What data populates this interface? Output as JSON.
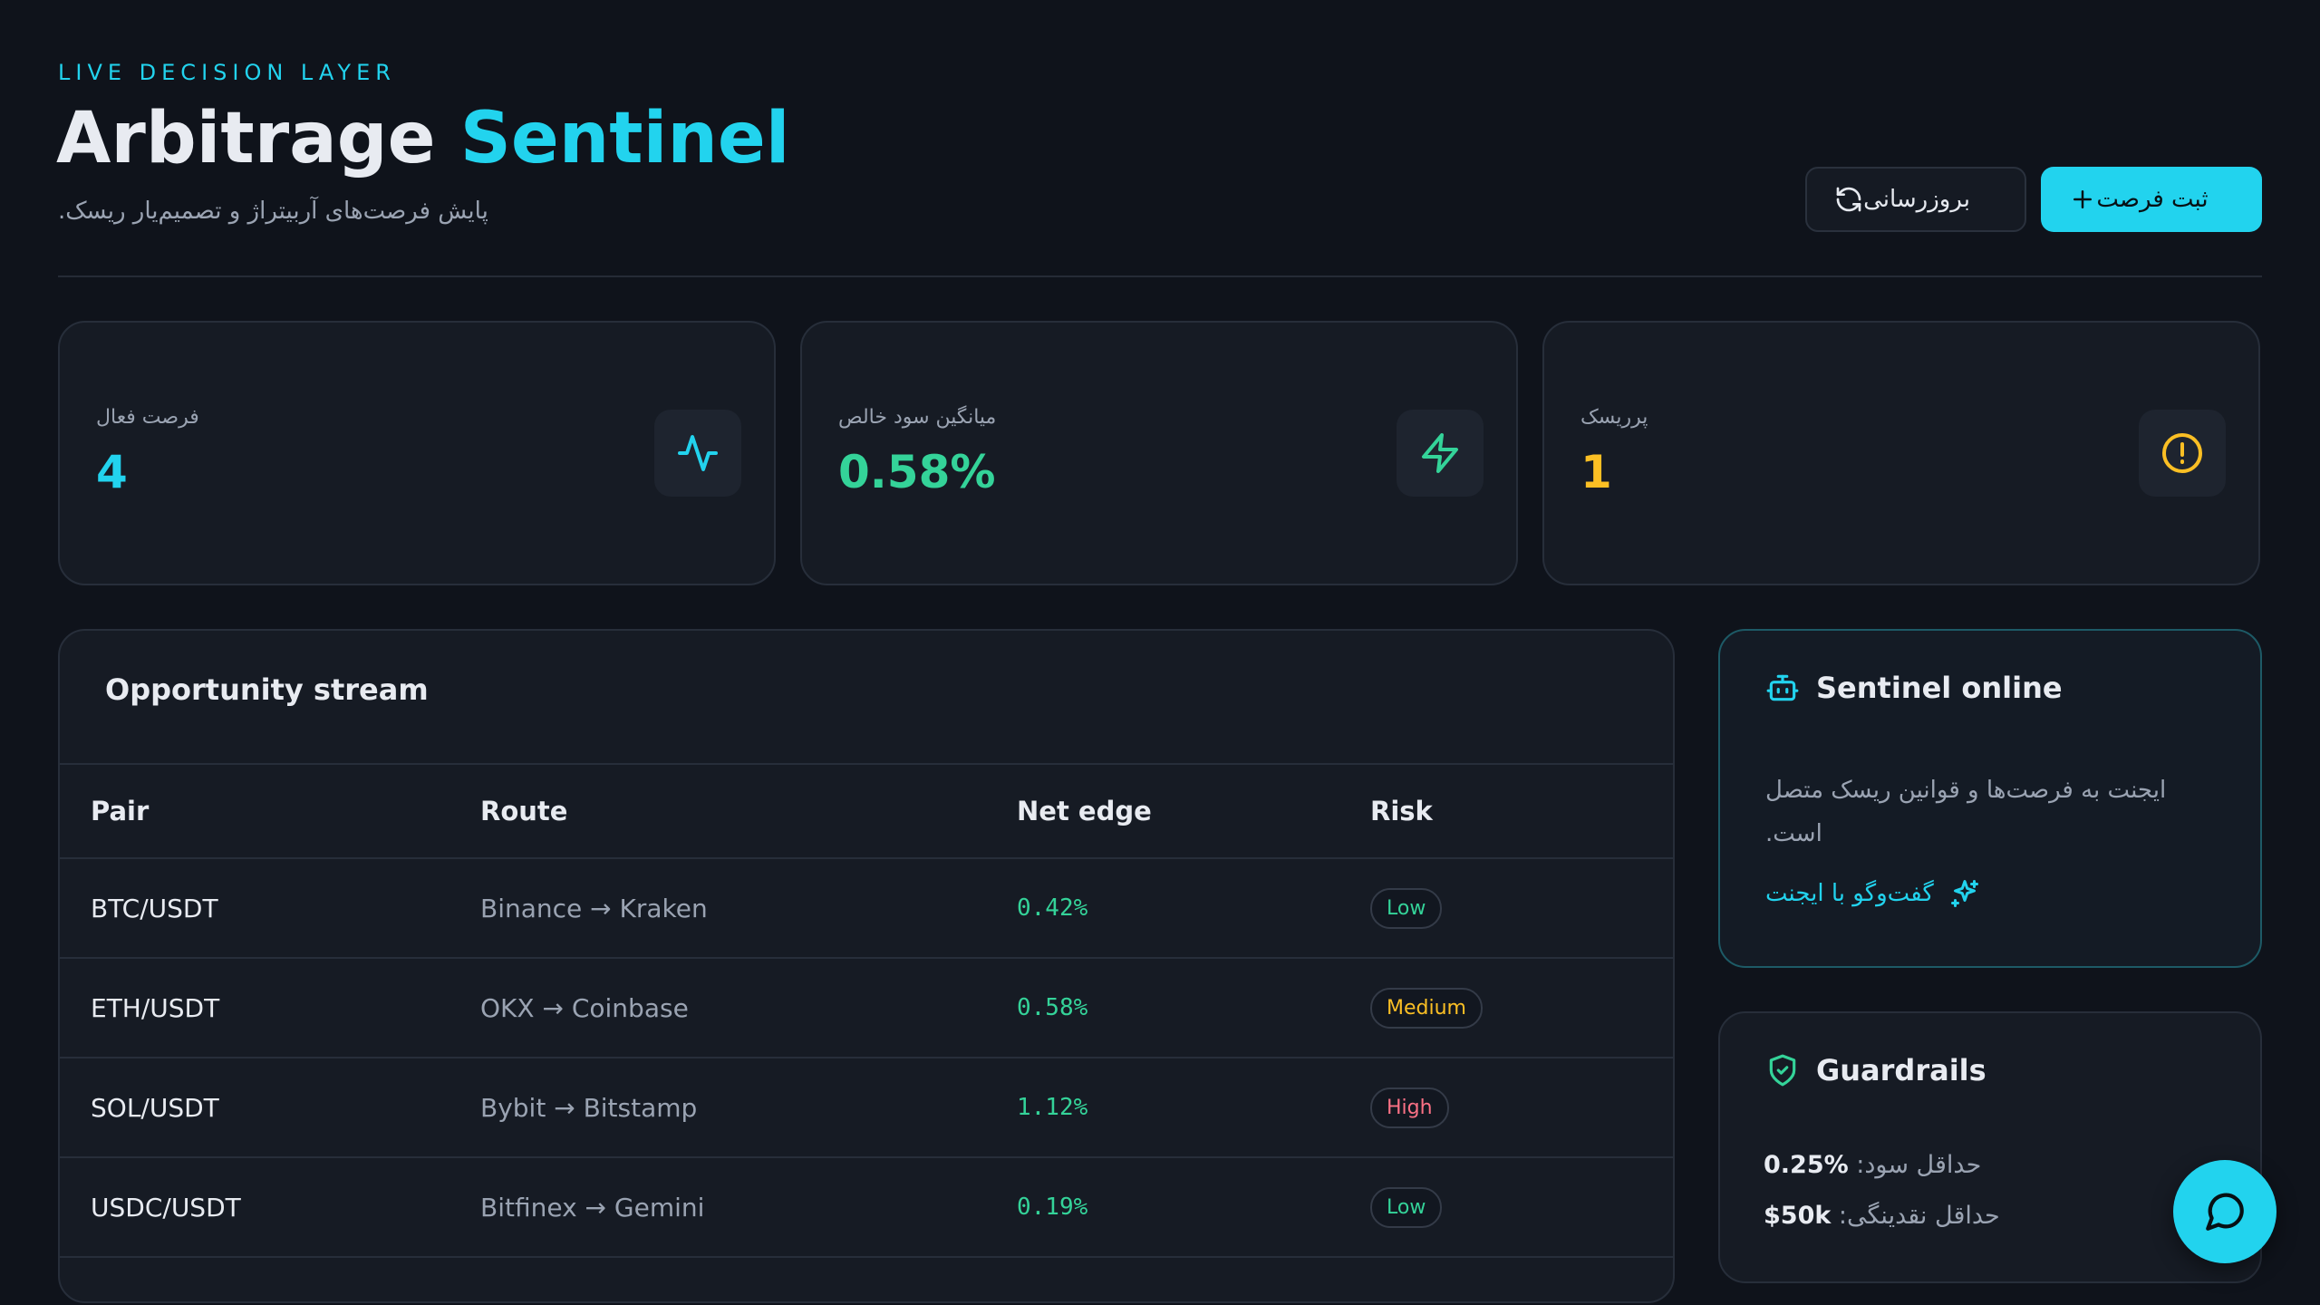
{
  "header": {
    "eyebrow": "LIVE DECISION LAYER",
    "title_main": "Arbitrage",
    "title_accent": "Sentinel",
    "subtitle": "پایش فرصت‌های آربیتراژ و تصمیم‌یار ریسک.",
    "refresh_label": "بروزرسانی",
    "add_label": "ثبت فرصت"
  },
  "stats": [
    {
      "label": "فرصت فعال",
      "value": "4",
      "color": "#22d3ee",
      "icon": "activity-icon"
    },
    {
      "label": "میانگین سود خالص",
      "value": "0.58%",
      "color": "#34d399",
      "icon": "zap-icon"
    },
    {
      "label": "پرریسک",
      "value": "1",
      "color": "#fbbf24",
      "icon": "alert-circle-icon"
    }
  ],
  "stream": {
    "title": "Opportunity stream",
    "columns": [
      "Pair",
      "Route",
      "Net edge",
      "Risk"
    ],
    "rows": [
      {
        "pair": "BTC/USDT",
        "route": "Binance → Kraken",
        "edge": "0.42%",
        "risk": "Low"
      },
      {
        "pair": "ETH/USDT",
        "route": "OKX → Coinbase",
        "edge": "0.58%",
        "risk": "Medium"
      },
      {
        "pair": "SOL/USDT",
        "route": "Bybit → Bitstamp",
        "edge": "1.12%",
        "risk": "High"
      },
      {
        "pair": "USDC/USDT",
        "route": "Bitfinex → Gemini",
        "edge": "0.19%",
        "risk": "Low"
      }
    ]
  },
  "sentinel": {
    "title": "Sentinel online",
    "text": "ایجنت به فرصت‌ها و قوانین ریسک متصل است.",
    "link": "گفت‌وگو با ایجنت"
  },
  "guardrails": {
    "title": "Guardrails",
    "rule1_label": "حداقل سود: ",
    "rule1_value": "0.25%",
    "rule2_label": "حداقل نقدینگی: ",
    "rule2_value": "$50k"
  },
  "colors": {
    "accent": "#22d3ee",
    "positive": "#34d399",
    "warning": "#fbbf24",
    "risk_low": "#34d399",
    "risk_medium": "#fbbf24",
    "risk_high": "#fb7185"
  }
}
